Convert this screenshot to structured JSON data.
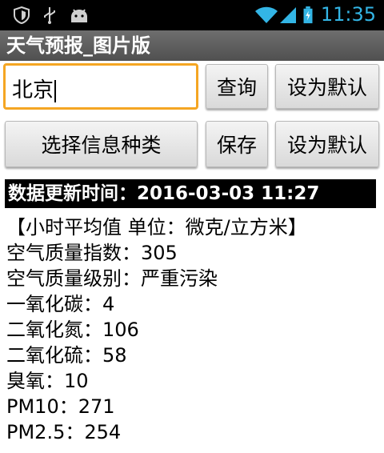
{
  "status_bar": {
    "time": "11:35"
  },
  "app": {
    "title": "天气预报_图片版"
  },
  "search": {
    "city_value": "北京"
  },
  "buttons": {
    "query": "查询",
    "set_default_1": "设为默认",
    "select_info_type": "选择信息种类",
    "save": "保存",
    "set_default_2": "设为默认"
  },
  "update_banner": "数据更新时间：2016-03-03 11:27",
  "air_quality": {
    "header": "【小时平均值 单位：微克/立方米】",
    "lines": [
      "空气质量指数：305",
      "空气质量级别：严重污染",
      "一氧化碳：4",
      "二氧化氮：106",
      "二氧化硫：58",
      "臭氧：10",
      "PM10：271",
      "PM2.5：254"
    ]
  }
}
